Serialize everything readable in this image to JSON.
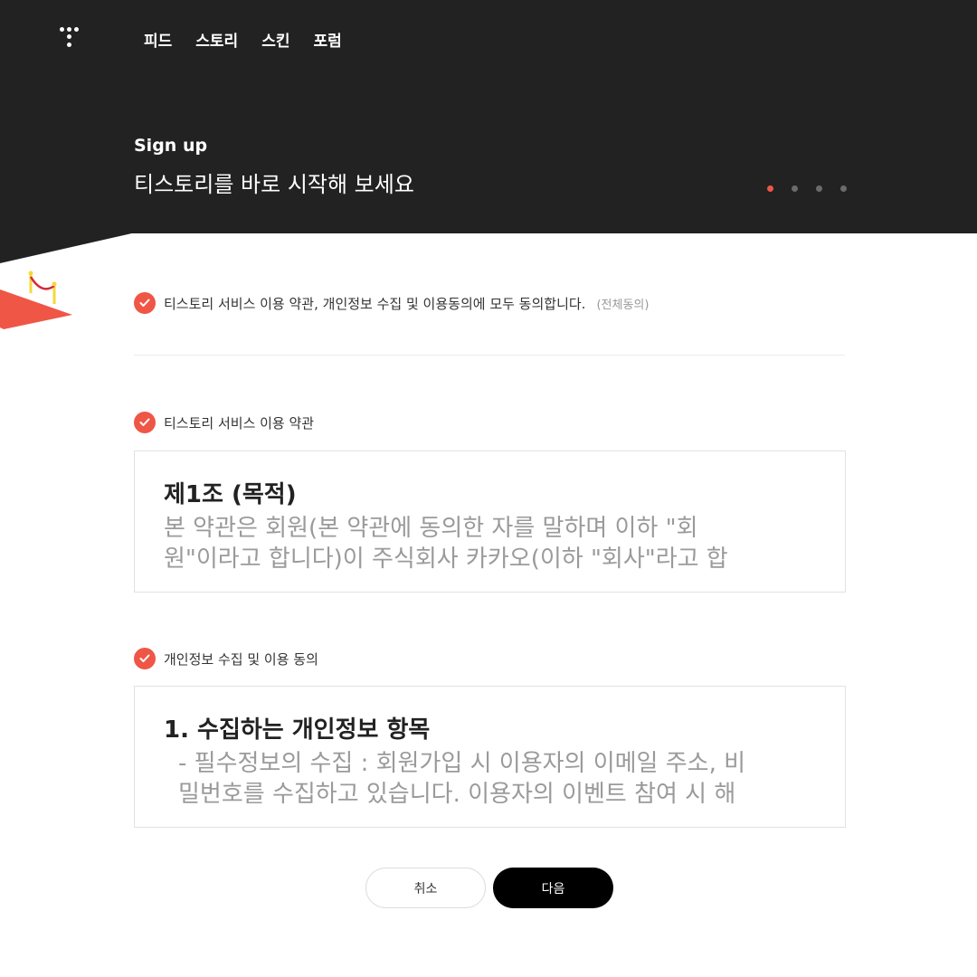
{
  "header": {
    "logo_icon": "tistory-logo-icon",
    "nav": [
      "피드",
      "스토리",
      "스킨",
      "포럼"
    ],
    "subtitle": "Sign up",
    "title": "티스토리를 바로 시작해 보세요",
    "steps": {
      "total": 4,
      "current": 1
    }
  },
  "agree_all": {
    "label": "티스토리 서비스 이용 약관, 개인정보 수집 및 이용동의에 모두 동의합니다.",
    "hint": "(전체동의)",
    "checked": true
  },
  "terms": {
    "label": "티스토리 서비스 이용 약관",
    "checked": true,
    "heading": "제1조 (목적)",
    "lines": [
      "본 약관은 회원(본 약관에 동의한 자를 말하며 이하 \"회",
      "원\"이라고 합니다)이 주식회사 카카오(이하 \"회사\"라고 합"
    ]
  },
  "privacy": {
    "label": "개인정보 수집 및 이용 동의",
    "checked": true,
    "heading": "1. 수집하는 개인정보 항목",
    "lines": [
      "- 필수정보의 수집 : 회원가입 시 이용자의 이메일 주소, 비",
      "밀번호를 수집하고 있습니다. 이용자의 이벤트 참여 시 해"
    ]
  },
  "buttons": {
    "cancel": "취소",
    "next": "다음"
  },
  "colors": {
    "accent": "#ef5646",
    "header_bg": "#222222",
    "primary_button": "#000000"
  }
}
